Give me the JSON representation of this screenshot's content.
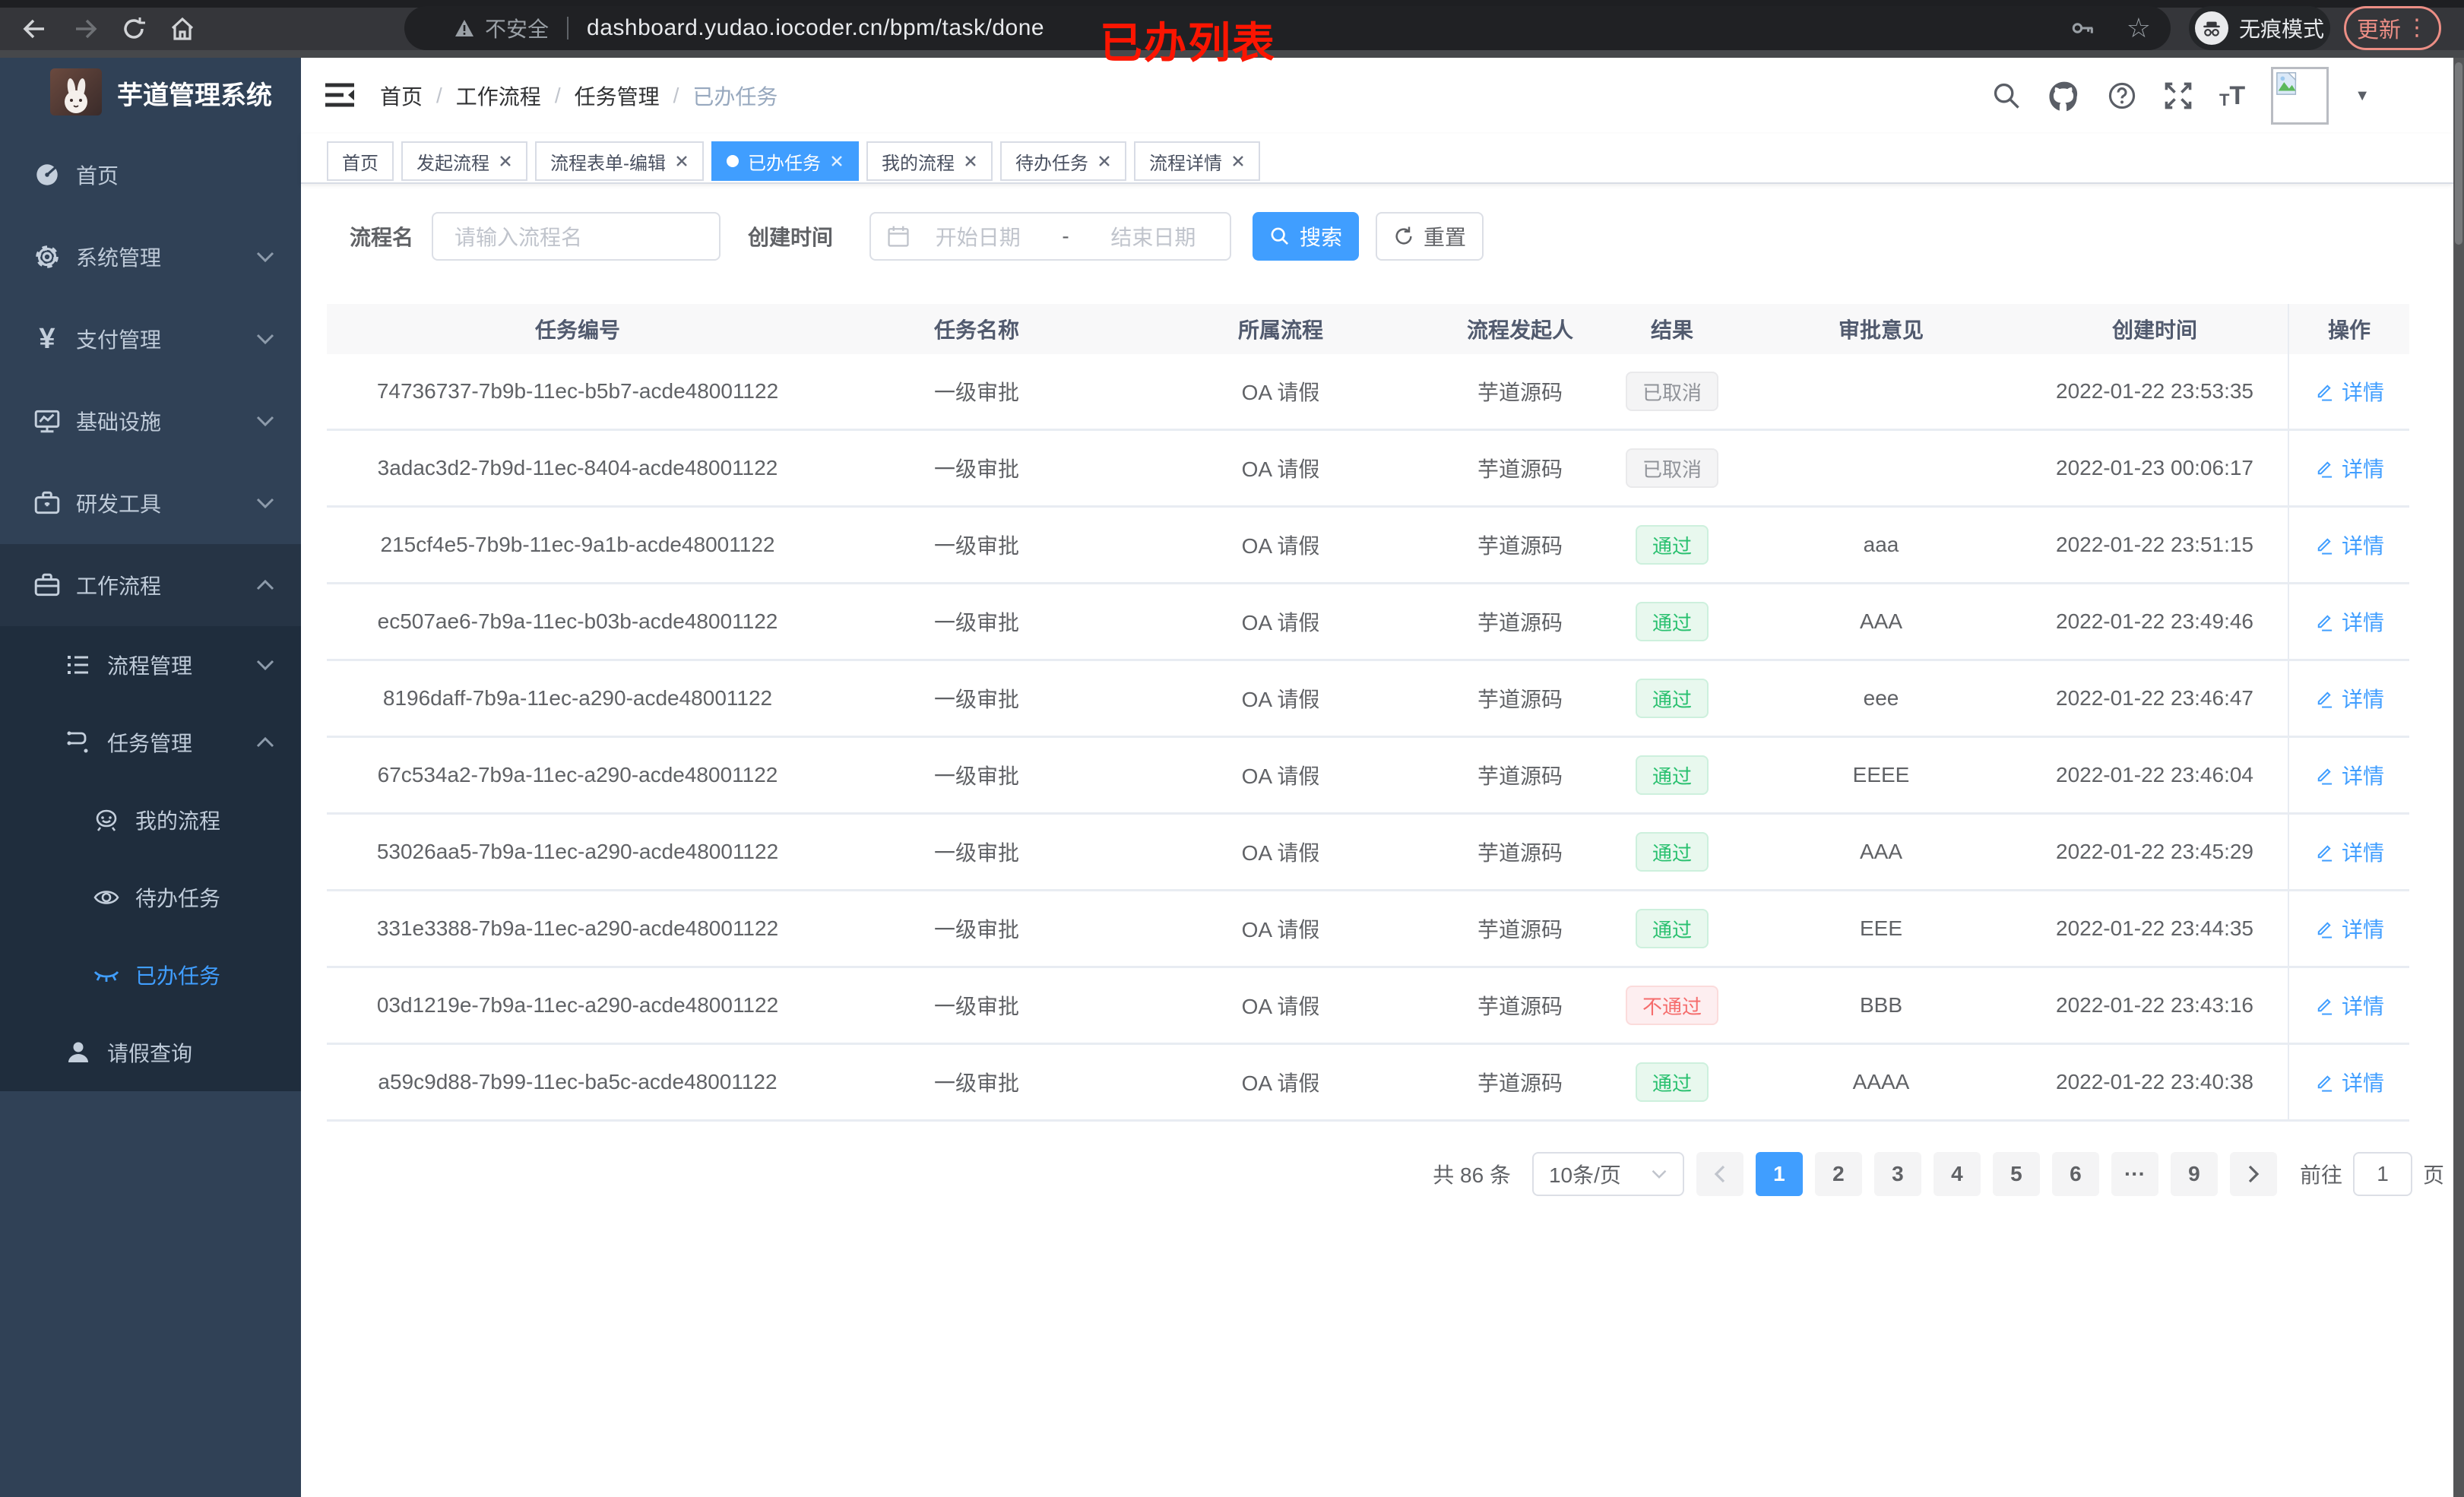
{
  "browser": {
    "security_label": "不安全",
    "url": "dashboard.yudao.iocoder.cn/bpm/task/done",
    "incognito_label": "无痕模式",
    "update_label": "更新"
  },
  "annotation": "已办列表",
  "colors": {
    "accent": "#409eff",
    "sidebar_bg": "#304156",
    "submenu_bg": "#1f2d3d",
    "success_tag": "#29c06f",
    "danger_tag": "#f56c6c",
    "info_tag": "#909399"
  },
  "sidebar": {
    "title": "芋道管理系统",
    "menu": [
      {
        "label": "首页",
        "icon": "gauge-icon"
      },
      {
        "label": "系统管理",
        "icon": "gear-icon",
        "expandable": true
      },
      {
        "label": "支付管理",
        "icon": "yen-icon",
        "expandable": true
      },
      {
        "label": "基础设施",
        "icon": "monitor-icon",
        "expandable": true
      },
      {
        "label": "研发工具",
        "icon": "toolbox-icon",
        "expandable": true
      },
      {
        "label": "工作流程",
        "icon": "briefcase-icon",
        "expanded": true
      },
      {
        "label": "流程管理",
        "icon": "list-icon",
        "expandable": true
      },
      {
        "label": "任务管理",
        "icon": "flow-icon",
        "expanded": true
      },
      {
        "label": "我的流程",
        "icon": "face-icon"
      },
      {
        "label": "待办任务",
        "icon": "eye-open-icon"
      },
      {
        "label": "已办任务",
        "icon": "eye-closed-icon",
        "active": true
      },
      {
        "label": "请假查询",
        "icon": "user-icon"
      }
    ]
  },
  "breadcrumb": {
    "separator": "/",
    "items": [
      "首页",
      "工作流程",
      "任务管理",
      "已办任务"
    ]
  },
  "tabs": [
    {
      "label": "首页",
      "closable": false,
      "active": false
    },
    {
      "label": "发起流程",
      "closable": true,
      "active": false
    },
    {
      "label": "流程表单-编辑",
      "closable": true,
      "active": false
    },
    {
      "label": "已办任务",
      "closable": true,
      "active": true
    },
    {
      "label": "我的流程",
      "closable": true,
      "active": false
    },
    {
      "label": "待办任务",
      "closable": true,
      "active": false
    },
    {
      "label": "流程详情",
      "closable": true,
      "active": false
    }
  ],
  "filters": {
    "name_label": "流程名",
    "name_placeholder": "请输入流程名",
    "time_label": "创建时间",
    "start_placeholder": "开始日期",
    "range_separator": "-",
    "end_placeholder": "结束日期",
    "search_label": "搜索",
    "reset_label": "重置"
  },
  "table": {
    "columns": [
      "任务编号",
      "任务名称",
      "所属流程",
      "流程发起人",
      "结果",
      "审批意见",
      "创建时间",
      "操作"
    ],
    "detail_label": "详情",
    "rows": [
      {
        "id": "74736737-7b9b-11ec-b5b7-acde48001122",
        "name": "一级审批",
        "process": "OA 请假",
        "starter": "芋道源码",
        "result": "已取消",
        "result_type": "info",
        "opinion": "",
        "created": "2022-01-22 23:53:35"
      },
      {
        "id": "3adac3d2-7b9d-11ec-8404-acde48001122",
        "name": "一级审批",
        "process": "OA 请假",
        "starter": "芋道源码",
        "result": "已取消",
        "result_type": "info",
        "opinion": "",
        "created": "2022-01-23 00:06:17"
      },
      {
        "id": "215cf4e5-7b9b-11ec-9a1b-acde48001122",
        "name": "一级审批",
        "process": "OA 请假",
        "starter": "芋道源码",
        "result": "通过",
        "result_type": "success",
        "opinion": "aaa",
        "created": "2022-01-22 23:51:15"
      },
      {
        "id": "ec507ae6-7b9a-11ec-b03b-acde48001122",
        "name": "一级审批",
        "process": "OA 请假",
        "starter": "芋道源码",
        "result": "通过",
        "result_type": "success",
        "opinion": "AAA",
        "created": "2022-01-22 23:49:46"
      },
      {
        "id": "8196daff-7b9a-11ec-a290-acde48001122",
        "name": "一级审批",
        "process": "OA 请假",
        "starter": "芋道源码",
        "result": "通过",
        "result_type": "success",
        "opinion": "eee",
        "created": "2022-01-22 23:46:47"
      },
      {
        "id": "67c534a2-7b9a-11ec-a290-acde48001122",
        "name": "一级审批",
        "process": "OA 请假",
        "starter": "芋道源码",
        "result": "通过",
        "result_type": "success",
        "opinion": "EEEE",
        "created": "2022-01-22 23:46:04"
      },
      {
        "id": "53026aa5-7b9a-11ec-a290-acde48001122",
        "name": "一级审批",
        "process": "OA 请假",
        "starter": "芋道源码",
        "result": "通过",
        "result_type": "success",
        "opinion": "AAA",
        "created": "2022-01-22 23:45:29"
      },
      {
        "id": "331e3388-7b9a-11ec-a290-acde48001122",
        "name": "一级审批",
        "process": "OA 请假",
        "starter": "芋道源码",
        "result": "通过",
        "result_type": "success",
        "opinion": "EEE",
        "created": "2022-01-22 23:44:35"
      },
      {
        "id": "03d1219e-7b9a-11ec-a290-acde48001122",
        "name": "一级审批",
        "process": "OA 请假",
        "starter": "芋道源码",
        "result": "不通过",
        "result_type": "danger",
        "opinion": "BBB",
        "created": "2022-01-22 23:43:16"
      },
      {
        "id": "a59c9d88-7b99-11ec-ba5c-acde48001122",
        "name": "一级审批",
        "process": "OA 请假",
        "starter": "芋道源码",
        "result": "通过",
        "result_type": "success",
        "opinion": "AAAA",
        "created": "2022-01-22 23:40:38"
      }
    ]
  },
  "pagination": {
    "total_label": "共 86 条",
    "page_size_label": "10条/页",
    "pages": [
      {
        "label": "1",
        "active": true
      },
      {
        "label": "2"
      },
      {
        "label": "3"
      },
      {
        "label": "4"
      },
      {
        "label": "5"
      },
      {
        "label": "6"
      },
      {
        "label": "···"
      },
      {
        "label": "9"
      }
    ],
    "goto_label": "前往",
    "goto_value": "1",
    "page_unit_label": "页"
  }
}
